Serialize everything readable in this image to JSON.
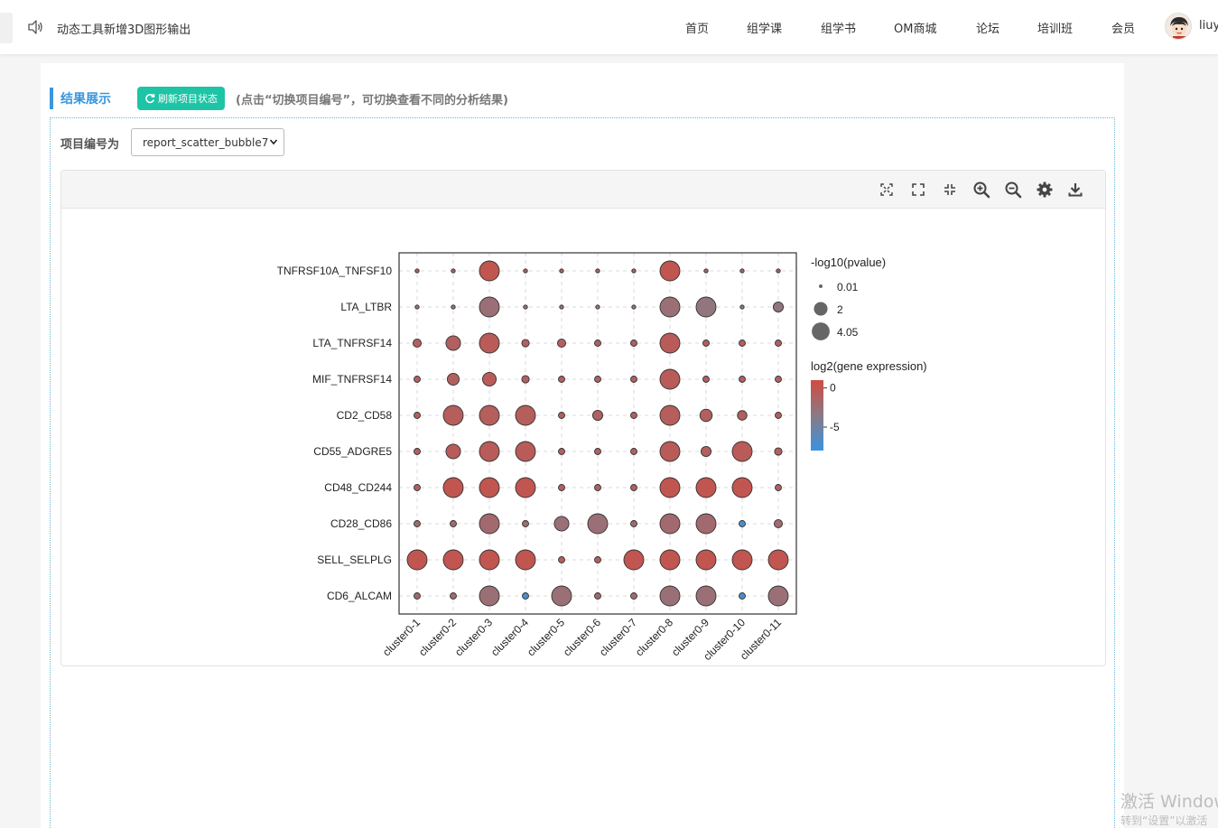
{
  "header": {
    "notice": "动态工具新增3D图形输出",
    "nav": [
      {
        "label": "首页"
      },
      {
        "label": "组学课"
      },
      {
        "label": "组学书"
      },
      {
        "label": "OM商城"
      },
      {
        "label": "论坛"
      },
      {
        "label": "培训班"
      },
      {
        "label": "会员"
      }
    ],
    "username": "liuy"
  },
  "section": {
    "title": "结果展示",
    "refresh_label": "刷新项目状态",
    "hint": "(点击“切换项目编号”，可切换查看不同的分析结果)"
  },
  "project": {
    "label": "项目编号为",
    "selected": "report_scatter_bubble7"
  },
  "toolbar": {
    "icons": [
      "fit-icon",
      "fullscreen-icon",
      "shrink-icon",
      "zoom-in-icon",
      "zoom-out-icon",
      "settings-icon",
      "download-icon"
    ]
  },
  "chart_data": {
    "type": "scatter",
    "x_categories": [
      "cluster0-1",
      "cluster0-2",
      "cluster0-3",
      "cluster0-4",
      "cluster0-5",
      "cluster0-6",
      "cluster0-7",
      "cluster0-8",
      "cluster0-9",
      "cluster0-10",
      "cluster0-11"
    ],
    "y_categories": [
      "TNFRSF10A_TNFSF10",
      "LTA_LTBR",
      "LTA_TNFRSF14",
      "MIF_TNFRSF14",
      "CD2_CD58",
      "CD55_ADGRE5",
      "CD48_CD244",
      "CD28_CD86",
      "SELL_SELPLG",
      "CD6_ALCAM"
    ],
    "size_legend": {
      "title": "-log10(pvalue)",
      "values": [
        0.01,
        2,
        4.05
      ]
    },
    "color_legend": {
      "title": "log2(gene expression)",
      "ticks": [
        0,
        -5
      ],
      "range": [
        -8,
        1
      ],
      "colors": [
        "#d14b41",
        "#8a7a85",
        "#3a93e0"
      ]
    },
    "grid": true,
    "rows": [
      {
        "y": "TNFRSF10A_TNFSF10",
        "pvalue": [
          0.01,
          0.01,
          4.05,
          0.01,
          0.01,
          0.01,
          0.01,
          4.05,
          0.01,
          0.01,
          0.01
        ],
        "expr": [
          -1,
          -1,
          0,
          -1,
          -1,
          -1,
          -1,
          0,
          -1,
          -1,
          -1
        ]
      },
      {
        "y": "LTA_LTBR",
        "pvalue": [
          0.01,
          0.01,
          4.05,
          0.01,
          0.01,
          0.01,
          0.01,
          4.05,
          4.05,
          0.01,
          0.6
        ],
        "expr": [
          -3,
          -3,
          -2.5,
          -3,
          -3,
          -3,
          -3,
          -2.5,
          -3,
          -3,
          -3
        ]
      },
      {
        "y": "LTA_TNFRSF14",
        "pvalue": [
          0.3,
          1.8,
          4.05,
          0.2,
          0.3,
          0.1,
          0.1,
          4.05,
          0.1,
          0.1,
          0.1
        ],
        "expr": [
          -1,
          -1,
          -0.5,
          -1,
          -1,
          -1,
          -1,
          -0.5,
          -1,
          -1,
          -1
        ]
      },
      {
        "y": "MIF_TNFRSF14",
        "pvalue": [
          0.1,
          1.0,
          1.5,
          0.2,
          0.1,
          0.1,
          0.1,
          4.05,
          0.1,
          0.1,
          0.1
        ],
        "expr": [
          -1,
          -1,
          -0.5,
          -1,
          -1,
          -1,
          -1,
          -0.5,
          -1,
          -1,
          -1
        ]
      },
      {
        "y": "CD2_CD58",
        "pvalue": [
          0.1,
          4.05,
          4.05,
          4.05,
          0.1,
          0.6,
          0.1,
          4.05,
          1.1,
          0.5,
          0.1
        ],
        "expr": [
          -1,
          -0.8,
          -0.8,
          -0.8,
          -1,
          -1,
          -1,
          -0.8,
          -1,
          -1,
          -1
        ]
      },
      {
        "y": "CD55_ADGRE5",
        "pvalue": [
          0.1,
          1.8,
          4.05,
          4.05,
          0.1,
          0.1,
          0.1,
          4.05,
          0.6,
          4.05,
          0.2
        ],
        "expr": [
          -1,
          -0.5,
          -0.5,
          -0.5,
          -1,
          -1,
          -1,
          -0.5,
          -1,
          -0.5,
          -1
        ]
      },
      {
        "y": "CD48_CD244",
        "pvalue": [
          0.1,
          4.05,
          4.05,
          4.05,
          0.1,
          0.1,
          0.1,
          4.05,
          4.05,
          4.05,
          0.1
        ],
        "expr": [
          -1,
          0,
          0,
          0,
          -1,
          -1,
          -1,
          0,
          0,
          0,
          -1
        ]
      },
      {
        "y": "CD28_CD86",
        "pvalue": [
          0.1,
          0.1,
          4.05,
          0.1,
          1.8,
          4.05,
          0.1,
          4.05,
          4.05,
          0.1,
          0.3
        ],
        "expr": [
          -2,
          -2,
          -2,
          -2,
          -2.5,
          -2.5,
          -2,
          -2,
          -2,
          -7,
          -2
        ]
      },
      {
        "y": "SELL_SELPLG",
        "pvalue": [
          4.05,
          4.05,
          4.05,
          4.05,
          0.1,
          0.1,
          4.05,
          4.05,
          4.05,
          4.05,
          4.05
        ],
        "expr": [
          0,
          0,
          0,
          0,
          -1,
          -1,
          0,
          0,
          0,
          0,
          0
        ]
      },
      {
        "y": "CD6_ALCAM",
        "pvalue": [
          0.1,
          0.1,
          4.05,
          0.1,
          4.05,
          0.1,
          0.1,
          4.05,
          4.05,
          0.1,
          4.05
        ],
        "expr": [
          -2,
          -2,
          -2.5,
          -7,
          -2.5,
          -2,
          -2,
          -2.5,
          -2.5,
          -7,
          -2.5
        ]
      }
    ]
  },
  "watermark": {
    "line1": "激活 Windows",
    "line2": "转到“设置”以激活"
  }
}
